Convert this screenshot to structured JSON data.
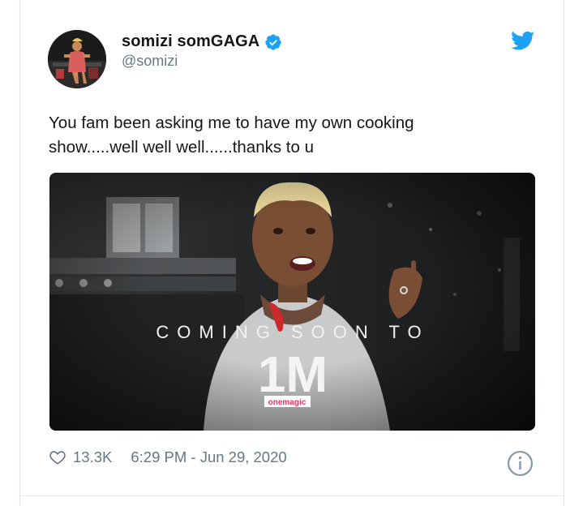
{
  "tweet": {
    "display_name": "somizi somGAGA",
    "handle": "@somizi",
    "text_line1": "You fam been asking me to have my own cooking",
    "text_line2": "show.....well well well......thanks to u",
    "likes": "13.3K",
    "timestamp": "6:29 PM - Jun 29, 2020"
  },
  "media": {
    "caption": "COMING SOON TO",
    "logo_mark": "1M",
    "logo_sub": "onemagic"
  },
  "colors": {
    "brand_blue": "#1da1f2",
    "text_primary": "#14171a",
    "text_secondary": "#657786"
  },
  "icons": {
    "verified": "verified-badge-icon",
    "bird": "twitter-bird-icon",
    "heart": "heart-icon",
    "info": "info-icon"
  }
}
